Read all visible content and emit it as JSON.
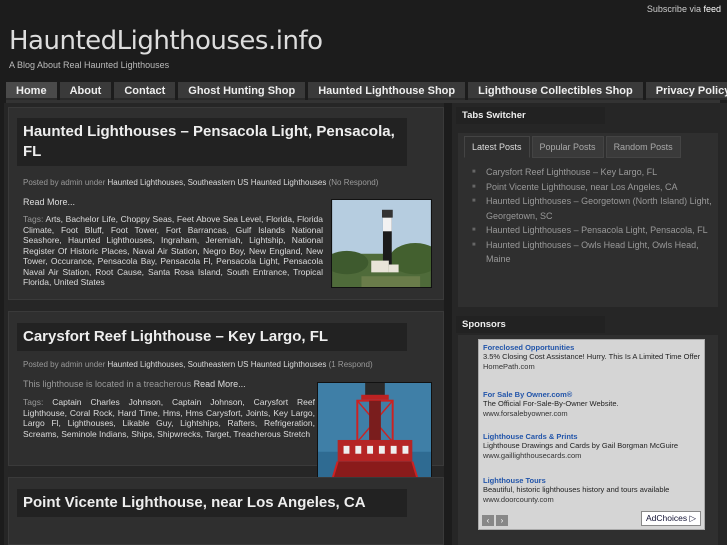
{
  "topbar": {
    "text": "Subscribe via",
    "feed_label": "feed"
  },
  "site": {
    "title": "HauntedLighthouses.info",
    "tagline": "A Blog About Real Haunted Lighthouses"
  },
  "nav": [
    "Home",
    "About",
    "Contact",
    "Ghost Hunting Shop",
    "Haunted Lighthouse Shop",
    "Lighthouse Collectibles Shop",
    "Privacy Policy"
  ],
  "posts": [
    {
      "title": "Haunted Lighthouses – Pensacola Light, Pensacola, FL",
      "meta_prefix": "Posted by admin under",
      "categories": "Haunted Lighthouses, Southeastern US Haunted Lighthouses",
      "responses": "(No Respond)",
      "read_more": "Read More...",
      "tags_label": "Tags:",
      "tags": "Arts, Bachelor Life, Choppy Seas, Feet Above Sea Level, Florida, Florida Climate, Foot Bluff, Foot Tower, Fort Barrancas, Gulf Islands National Seashore, Haunted Lighthouses, Ingraham, Jeremiah, Lightship, National Register Of Historic Places, Naval Air Station, Negro Boy, New England, New Tower, Occurance, Pensacola Bay, Pensacola Fl, Pensacola Light, Pensacola Naval Air Station, Root Cause, Santa Rosa Island, South Entrance, Tropical Florida, United States"
    },
    {
      "title": "Carysfort Reef Lighthouse – Key Largo, FL",
      "meta_prefix": "Posted by admin under",
      "categories": "Haunted Lighthouses, Southeastern US Haunted Lighthouses",
      "responses": "(1 Respond)",
      "excerpt": "This lighthouse is located in a treacherous",
      "read_more": "Read More...",
      "tags_label": "Tags:",
      "tags": "Captain Charles Johnson, Captain Johnson, Carysfort Reef Lighthouse, Coral Rock, Hard Time, Hms, Hms Carysfort, Joints, Key Largo, Largo Fl, Lighthouses, Likable Guy, Lightships, Rafters, Refrigeration, Screams, Seminole Indians, Ships, Shipwrecks, Target, Treacherous Stretch"
    },
    {
      "title": "Point Vicente Lighthouse, near Los Angeles, CA"
    }
  ],
  "sidebar": {
    "tabs_title": "Tabs Switcher",
    "tabs": [
      "Latest Posts",
      "Popular Posts",
      "Random Posts"
    ],
    "latest": [
      "Carysfort Reef Lighthouse – Key Largo, FL",
      "Point Vicente Lighthouse, near Los Angeles, CA",
      "Haunted Lighthouses – Georgetown (North Island) Light, Georgetown, SC",
      "Haunted Lighthouses – Pensacola Light, Pensacola, FL",
      "Haunted Lighthouses – Owls Head Light, Owls Head, Maine"
    ],
    "sponsors_title": "Sponsors",
    "ads": [
      {
        "head": "Foreclosed Opportunities",
        "body": "3.5% Closing Cost Assistance! Hurry. This Is A Limited Time Offer",
        "url": "HomePath.com"
      },
      {
        "head": "For Sale By Owner.com®",
        "body": "The Official For-Sale-By-Owner Website.",
        "url": "www.forsalebyowner.com"
      },
      {
        "head": "Lighthouse Cards & Prints",
        "body": "Lighthouse Drawings and Cards by Gail Borgman McGuire",
        "url": "www.gaillighthousecards.com"
      },
      {
        "head": "Lighthouse Tours",
        "body": "Beautiful, historic lighthouses history and tours available",
        "url": "www.doorcounty.com"
      }
    ],
    "adchoices": "AdChoices ▷"
  }
}
